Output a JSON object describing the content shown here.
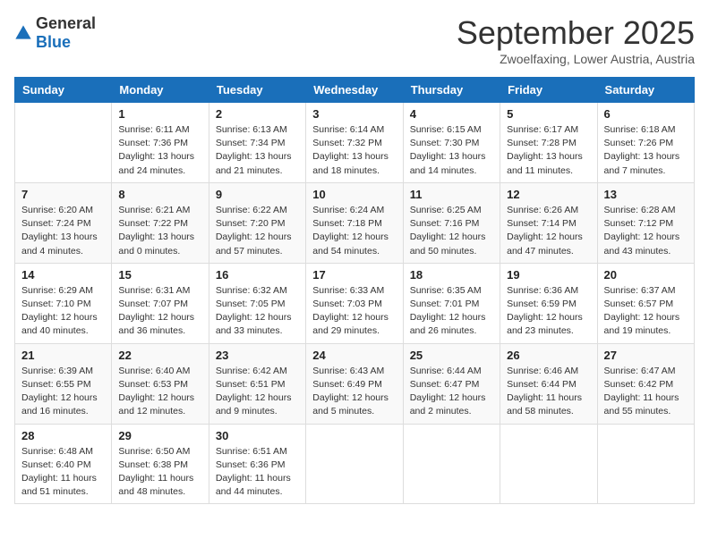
{
  "header": {
    "logo_general": "General",
    "logo_blue": "Blue",
    "title": "September 2025",
    "location": "Zwoelfaxing, Lower Austria, Austria"
  },
  "days_of_week": [
    "Sunday",
    "Monday",
    "Tuesday",
    "Wednesday",
    "Thursday",
    "Friday",
    "Saturday"
  ],
  "weeks": [
    [
      {
        "day": "",
        "info": ""
      },
      {
        "day": "1",
        "info": "Sunrise: 6:11 AM\nSunset: 7:36 PM\nDaylight: 13 hours and 24 minutes."
      },
      {
        "day": "2",
        "info": "Sunrise: 6:13 AM\nSunset: 7:34 PM\nDaylight: 13 hours and 21 minutes."
      },
      {
        "day": "3",
        "info": "Sunrise: 6:14 AM\nSunset: 7:32 PM\nDaylight: 13 hours and 18 minutes."
      },
      {
        "day": "4",
        "info": "Sunrise: 6:15 AM\nSunset: 7:30 PM\nDaylight: 13 hours and 14 minutes."
      },
      {
        "day": "5",
        "info": "Sunrise: 6:17 AM\nSunset: 7:28 PM\nDaylight: 13 hours and 11 minutes."
      },
      {
        "day": "6",
        "info": "Sunrise: 6:18 AM\nSunset: 7:26 PM\nDaylight: 13 hours and 7 minutes."
      }
    ],
    [
      {
        "day": "7",
        "info": "Sunrise: 6:20 AM\nSunset: 7:24 PM\nDaylight: 13 hours and 4 minutes."
      },
      {
        "day": "8",
        "info": "Sunrise: 6:21 AM\nSunset: 7:22 PM\nDaylight: 13 hours and 0 minutes."
      },
      {
        "day": "9",
        "info": "Sunrise: 6:22 AM\nSunset: 7:20 PM\nDaylight: 12 hours and 57 minutes."
      },
      {
        "day": "10",
        "info": "Sunrise: 6:24 AM\nSunset: 7:18 PM\nDaylight: 12 hours and 54 minutes."
      },
      {
        "day": "11",
        "info": "Sunrise: 6:25 AM\nSunset: 7:16 PM\nDaylight: 12 hours and 50 minutes."
      },
      {
        "day": "12",
        "info": "Sunrise: 6:26 AM\nSunset: 7:14 PM\nDaylight: 12 hours and 47 minutes."
      },
      {
        "day": "13",
        "info": "Sunrise: 6:28 AM\nSunset: 7:12 PM\nDaylight: 12 hours and 43 minutes."
      }
    ],
    [
      {
        "day": "14",
        "info": "Sunrise: 6:29 AM\nSunset: 7:10 PM\nDaylight: 12 hours and 40 minutes."
      },
      {
        "day": "15",
        "info": "Sunrise: 6:31 AM\nSunset: 7:07 PM\nDaylight: 12 hours and 36 minutes."
      },
      {
        "day": "16",
        "info": "Sunrise: 6:32 AM\nSunset: 7:05 PM\nDaylight: 12 hours and 33 minutes."
      },
      {
        "day": "17",
        "info": "Sunrise: 6:33 AM\nSunset: 7:03 PM\nDaylight: 12 hours and 29 minutes."
      },
      {
        "day": "18",
        "info": "Sunrise: 6:35 AM\nSunset: 7:01 PM\nDaylight: 12 hours and 26 minutes."
      },
      {
        "day": "19",
        "info": "Sunrise: 6:36 AM\nSunset: 6:59 PM\nDaylight: 12 hours and 23 minutes."
      },
      {
        "day": "20",
        "info": "Sunrise: 6:37 AM\nSunset: 6:57 PM\nDaylight: 12 hours and 19 minutes."
      }
    ],
    [
      {
        "day": "21",
        "info": "Sunrise: 6:39 AM\nSunset: 6:55 PM\nDaylight: 12 hours and 16 minutes."
      },
      {
        "day": "22",
        "info": "Sunrise: 6:40 AM\nSunset: 6:53 PM\nDaylight: 12 hours and 12 minutes."
      },
      {
        "day": "23",
        "info": "Sunrise: 6:42 AM\nSunset: 6:51 PM\nDaylight: 12 hours and 9 minutes."
      },
      {
        "day": "24",
        "info": "Sunrise: 6:43 AM\nSunset: 6:49 PM\nDaylight: 12 hours and 5 minutes."
      },
      {
        "day": "25",
        "info": "Sunrise: 6:44 AM\nSunset: 6:47 PM\nDaylight: 12 hours and 2 minutes."
      },
      {
        "day": "26",
        "info": "Sunrise: 6:46 AM\nSunset: 6:44 PM\nDaylight: 11 hours and 58 minutes."
      },
      {
        "day": "27",
        "info": "Sunrise: 6:47 AM\nSunset: 6:42 PM\nDaylight: 11 hours and 55 minutes."
      }
    ],
    [
      {
        "day": "28",
        "info": "Sunrise: 6:48 AM\nSunset: 6:40 PM\nDaylight: 11 hours and 51 minutes."
      },
      {
        "day": "29",
        "info": "Sunrise: 6:50 AM\nSunset: 6:38 PM\nDaylight: 11 hours and 48 minutes."
      },
      {
        "day": "30",
        "info": "Sunrise: 6:51 AM\nSunset: 6:36 PM\nDaylight: 11 hours and 44 minutes."
      },
      {
        "day": "",
        "info": ""
      },
      {
        "day": "",
        "info": ""
      },
      {
        "day": "",
        "info": ""
      },
      {
        "day": "",
        "info": ""
      }
    ]
  ]
}
